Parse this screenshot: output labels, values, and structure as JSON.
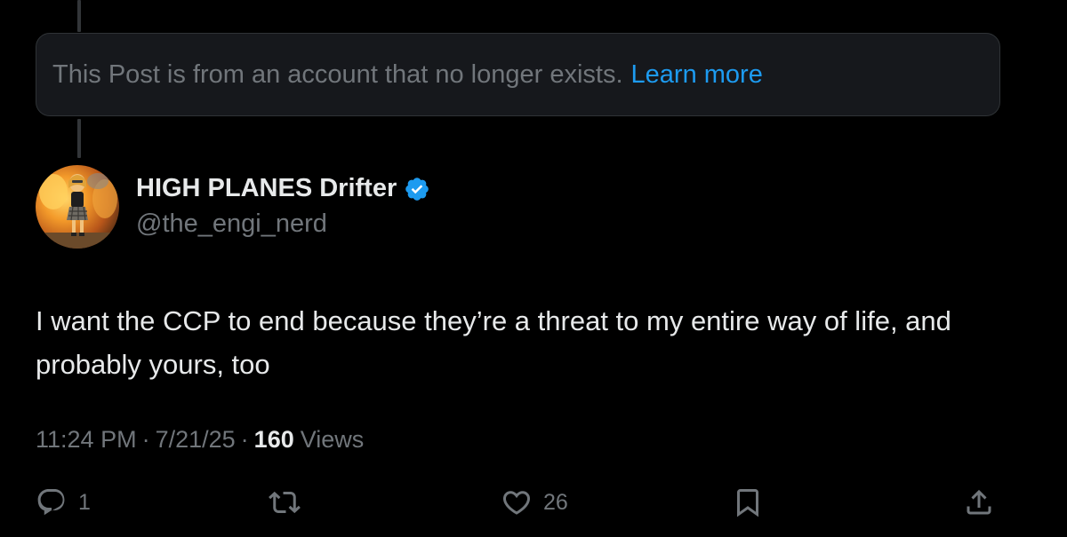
{
  "notice": {
    "text": "This Post is from an account that no longer exists.",
    "link_label": "Learn more"
  },
  "author": {
    "display_name": "HIGH PLANES Drifter",
    "handle": "@the_engi_nerd",
    "verified": true,
    "avatar_icon": "avatar-illustration"
  },
  "post": {
    "text": "I want the CCP to end because they’re a threat to my entire way of life, and probably yours, too"
  },
  "meta": {
    "time": "11:24 PM",
    "date": "7/21/25",
    "separator": "·",
    "views_count": "160",
    "views_label": "Views"
  },
  "actions": {
    "reply": {
      "icon": "reply-icon",
      "count": "1"
    },
    "repost": {
      "icon": "repost-icon",
      "count": ""
    },
    "like": {
      "icon": "heart-icon",
      "count": "26"
    },
    "bookmark": {
      "icon": "bookmark-icon",
      "count": ""
    },
    "share": {
      "icon": "share-icon",
      "count": ""
    }
  },
  "colors": {
    "background": "#000000",
    "text_primary": "#e7e9ea",
    "text_secondary": "#71767b",
    "accent": "#1d9bf0",
    "notice_background": "#16181c",
    "border": "#2f3336"
  }
}
